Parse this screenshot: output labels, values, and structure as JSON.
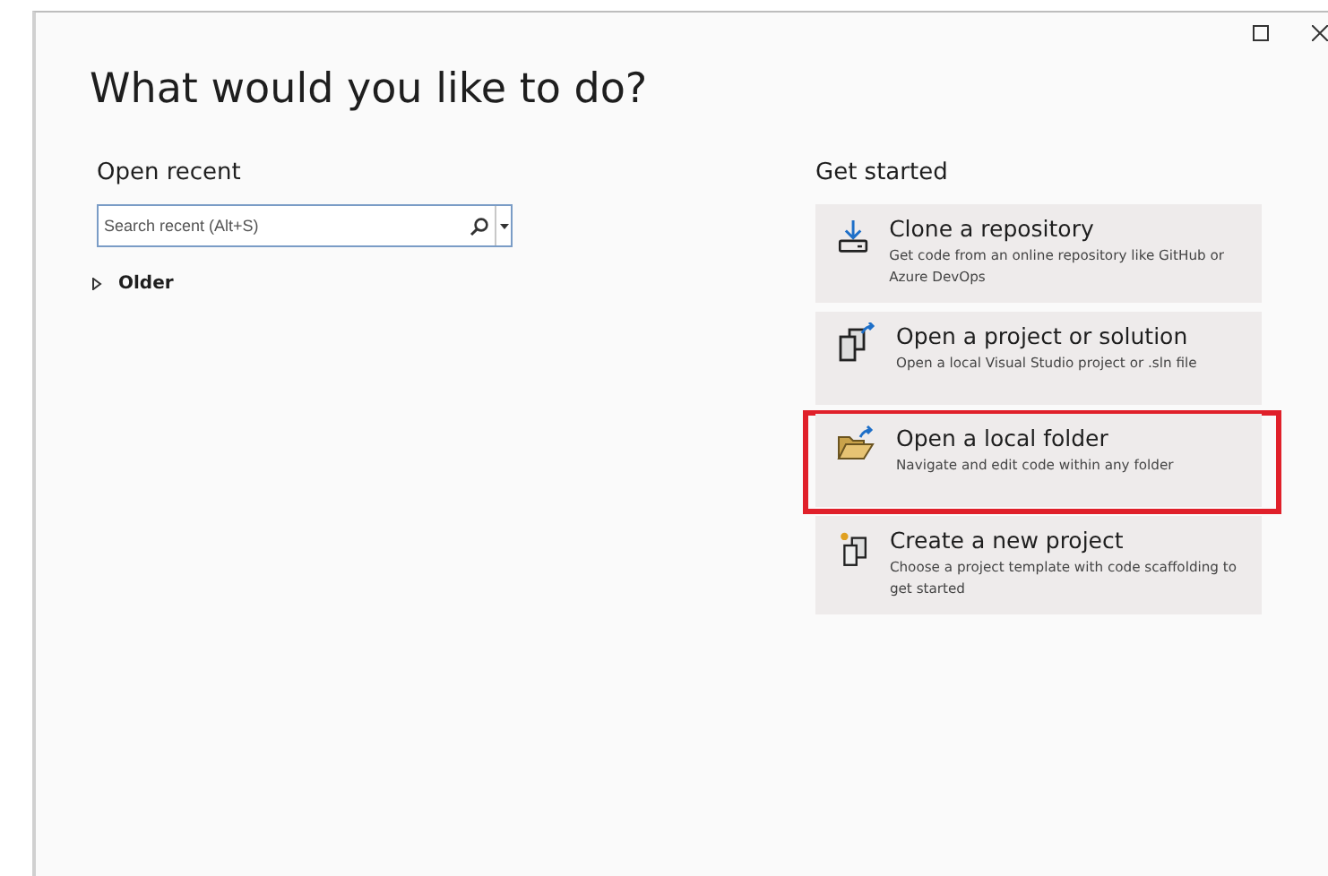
{
  "window": {
    "title": "What would you like to do?"
  },
  "open_recent": {
    "heading": "Open recent",
    "search": {
      "placeholder": "Search recent (Alt+S)"
    },
    "groups": [
      {
        "label": "Older",
        "expanded": false
      }
    ]
  },
  "get_started": {
    "heading": "Get started",
    "actions": [
      {
        "kind": "clone",
        "title": "Clone a repository",
        "description": "Get code from an online repository like GitHub or Azure DevOps",
        "highlighted": false
      },
      {
        "kind": "project",
        "title": "Open a project or solution",
        "description": "Open a local Visual Studio project or .sln file",
        "highlighted": false
      },
      {
        "kind": "folder",
        "title": "Open a local folder",
        "description": "Navigate and edit code within any folder",
        "highlighted": true
      },
      {
        "kind": "new",
        "title": "Create a new project",
        "description": "Choose a project template with code scaffolding to get started",
        "highlighted": false
      }
    ]
  }
}
